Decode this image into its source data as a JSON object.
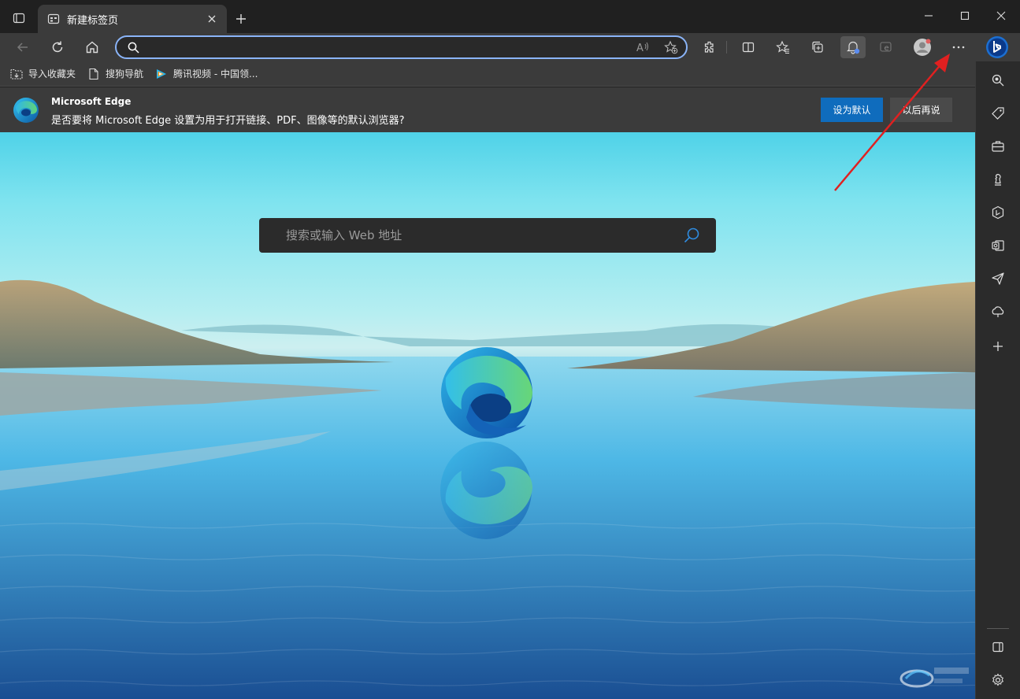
{
  "tab": {
    "title": "新建标签页"
  },
  "toolbar": {
    "address_value": ""
  },
  "favorites": [
    {
      "label": "导入收藏夹",
      "icon": "import-favorites-icon"
    },
    {
      "label": "搜狗导航",
      "icon": "page-icon"
    },
    {
      "label": "腾讯视频 - 中国领...",
      "icon": "tencent-video-icon"
    }
  ],
  "banner": {
    "title": "Microsoft Edge",
    "body": "是否要将 Microsoft Edge 设置为用于打开链接、PDF、图像等的默认浏览器?",
    "primary": "设为默认",
    "secondary": "以后再说"
  },
  "search": {
    "placeholder": "搜索或输入 Web 地址"
  },
  "sidebar": [
    "search-icon",
    "tag-icon",
    "toolbox-icon",
    "chess-icon",
    "office-icon",
    "outlook-icon",
    "send-icon",
    "cloud-icon",
    "add-icon",
    "panel-icon",
    "settings-icon"
  ],
  "colors": {
    "accent": "#0f6cbd",
    "annotation_arrow": "#e02020"
  }
}
